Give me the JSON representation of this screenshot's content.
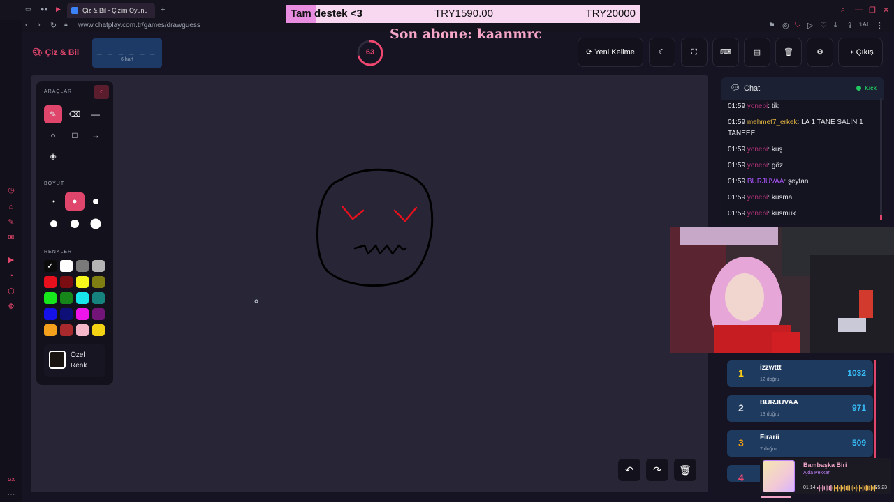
{
  "browser": {
    "tab_title": "Çiz & Bil - Çizim Oyunu",
    "url": "www.chatplay.com.tr/games/drawguess",
    "gx_label": "GX"
  },
  "overlay": {
    "donation_highlight": "Tam",
    "donation_message": "destek <3",
    "donation_amount": "TRY1590.00",
    "donation_goal": "TRY20000",
    "last_subscriber": "Son abone: kaanmrc"
  },
  "header": {
    "brand": "Çiz & Bil",
    "word_pattern": "_ _ _ _ _ _",
    "word_length": "6 harf",
    "timer": "63",
    "timer_progress": 0.7,
    "new_word_label": "Yeni Kelime",
    "logout_label": "Çıkış"
  },
  "tools": {
    "tools_title": "ARAÇLAR",
    "size_title": "BOYUT",
    "colors_title": "RENKLER",
    "custom_color_label": "Özel Renk",
    "colors": [
      "#0b0b0b",
      "#ffffff",
      "#7a7a7a",
      "#b5b5b5",
      "#e8101c",
      "#7a0d12",
      "#f6f61c",
      "#7e7e13",
      "#17e81c",
      "#16851a",
      "#17e7ea",
      "#15827e",
      "#1412e8",
      "#0e1077",
      "#ed15ea",
      "#731478",
      "#f3a01c",
      "#a82a2c",
      "#f5b8cb",
      "#f3d213"
    ]
  },
  "chat": {
    "title": "Chat",
    "platform": "Kick",
    "messages": [
      {
        "time": "01:59",
        "user": "yonebi",
        "text": ": tik",
        "color": "#b3337a"
      },
      {
        "time": "01:59",
        "user": "mehmet7_erkek",
        "text": ": LA 1 TANE SALİN 1 TANEEE",
        "color": "#e0b341"
      },
      {
        "time": "01:59",
        "user": "yonebi",
        "text": ": kuş",
        "color": "#b3337a"
      },
      {
        "time": "01:59",
        "user": "yonebi",
        "text": ": göz",
        "color": "#b3337a"
      },
      {
        "time": "01:59",
        "user": "BURJUVAA",
        "text": ": şeytan",
        "color": "#a855f7"
      },
      {
        "time": "01:59",
        "user": "yonebi",
        "text": ": kusma",
        "color": "#b3337a"
      },
      {
        "time": "01:59",
        "user": "yonebi",
        "text": ": kusmuk",
        "color": "#b3337a"
      }
    ]
  },
  "leaderboard": [
    {
      "rank": "1",
      "name": "izzwttt",
      "sub": "12 doğru",
      "points": "1032",
      "color": "#facc15"
    },
    {
      "rank": "2",
      "name": "BURJUVAA",
      "sub": "13 doğru",
      "points": "971",
      "color": "#e5e7eb"
    },
    {
      "rank": "3",
      "name": "Firarii",
      "sub": "7 doğru",
      "points": "509",
      "color": "#f59e0b"
    },
    {
      "rank": "4",
      "name": "",
      "sub": "",
      "points": "",
      "color": "#ef476f"
    }
  ],
  "music": {
    "song": "Bambaşka Biri",
    "artist": "Ajda Pekkan",
    "current_time": "01:14",
    "total_time": "05:23",
    "progress": 0.23
  }
}
